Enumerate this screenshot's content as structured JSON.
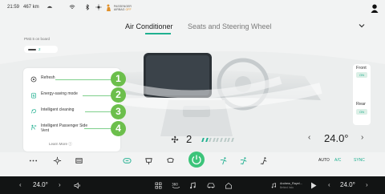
{
  "status": {
    "time": "21:59",
    "range": "467 km",
    "airbag_line1": "PASSENGER",
    "airbag_line2": "AIRBAG",
    "airbag_state": "OFF"
  },
  "tabs": [
    {
      "label": "Air Conditioner",
      "active": true
    },
    {
      "label": "Seats and Steering Wheel",
      "active": false
    }
  ],
  "pm": {
    "label": "PM2.5 on board",
    "value": "2"
  },
  "features": [
    {
      "label": "Refresh",
      "icon": "refresh-icon"
    },
    {
      "label": "Energy-saving mode",
      "icon": "energy-icon"
    },
    {
      "label": "Intelligent cleaning",
      "icon": "cleaning-icon"
    },
    {
      "label": "Intelligent Passenger Side Vent",
      "icon": "passenger-vent-icon"
    }
  ],
  "learn_more": "Learn More",
  "callouts": [
    "1",
    "2",
    "3",
    "4"
  ],
  "zones": {
    "front_label": "Front",
    "front_state": "ON",
    "rear_label": "Rear",
    "rear_state": "ON"
  },
  "fan": {
    "level_text": "2",
    "level": 2,
    "max": 9
  },
  "climate": {
    "temp_right": "24.0°",
    "auto_label": "AUTO",
    "ac_label": "A/C",
    "sync_label": "SYNC"
  },
  "dock": {
    "temp_left": "24.0°",
    "temp_right": "24.0°",
    "track_title": "Andrew_Rayel...",
    "track_artist": "Behind Indo"
  },
  "colors": {
    "accent": "#20b090",
    "callout": "#6cbf4c",
    "power": "#3cc47a",
    "dock": "#121414"
  }
}
